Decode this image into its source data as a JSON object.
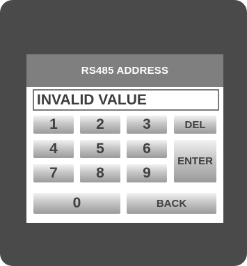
{
  "keypad": {
    "title": "RS485 ADDRESS",
    "display_value": "INVALID VALUE",
    "keys": {
      "k1": "1",
      "k2": "2",
      "k3": "3",
      "k4": "4",
      "k5": "5",
      "k6": "6",
      "k7": "7",
      "k8": "8",
      "k9": "9",
      "k0": "0",
      "del": "DEL",
      "enter": "ENTER",
      "back": "BACK"
    }
  },
  "colors": {
    "bezel": "#4a4a4a",
    "title_bar": "#7f7f7f",
    "key_text": "#404040"
  }
}
